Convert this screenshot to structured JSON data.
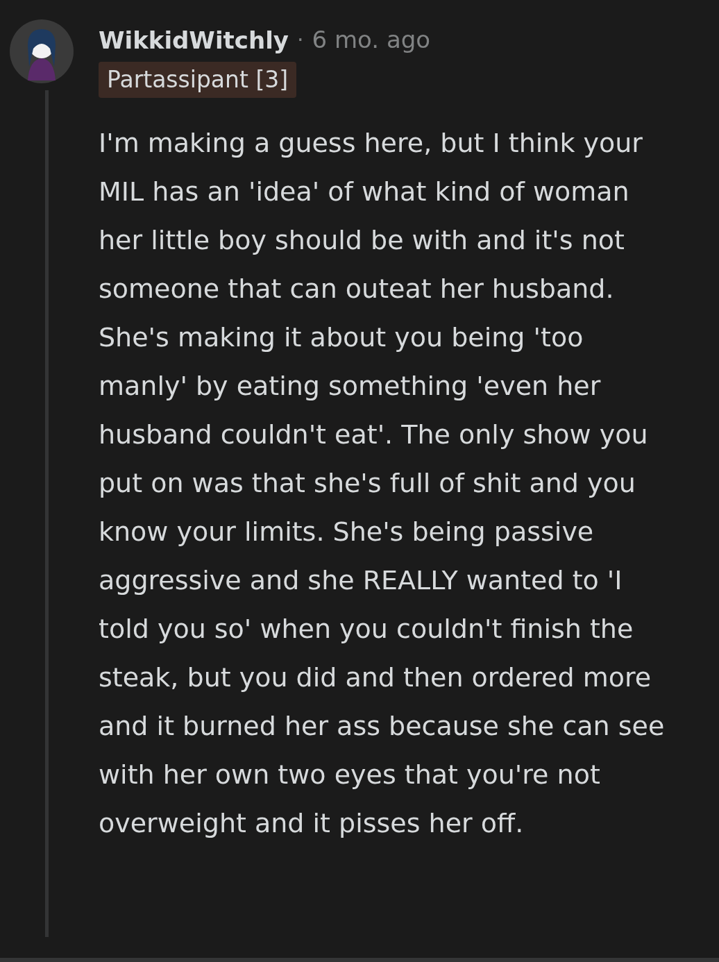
{
  "comment": {
    "author": "WikkidWitchly",
    "separator": "·",
    "time": "6 mo. ago",
    "flair": "Partassipant [3]",
    "body": "I'm making a guess here, but I think your MIL has an 'idea' of what kind of woman her little boy should be with and it's not someone that can outeat her husband. She's making it about you being 'too manly' by eating something 'even her husband couldn't eat'. The only show you put on was that she's full of shit and you know your limits. She's being passive aggressive and she REALLY wanted to 'I told you so' when you couldn't finish the steak, but you did and then ordered more and it burned her ass because she can see with her own two eyes that you're not overweight and it pisses her off."
  }
}
